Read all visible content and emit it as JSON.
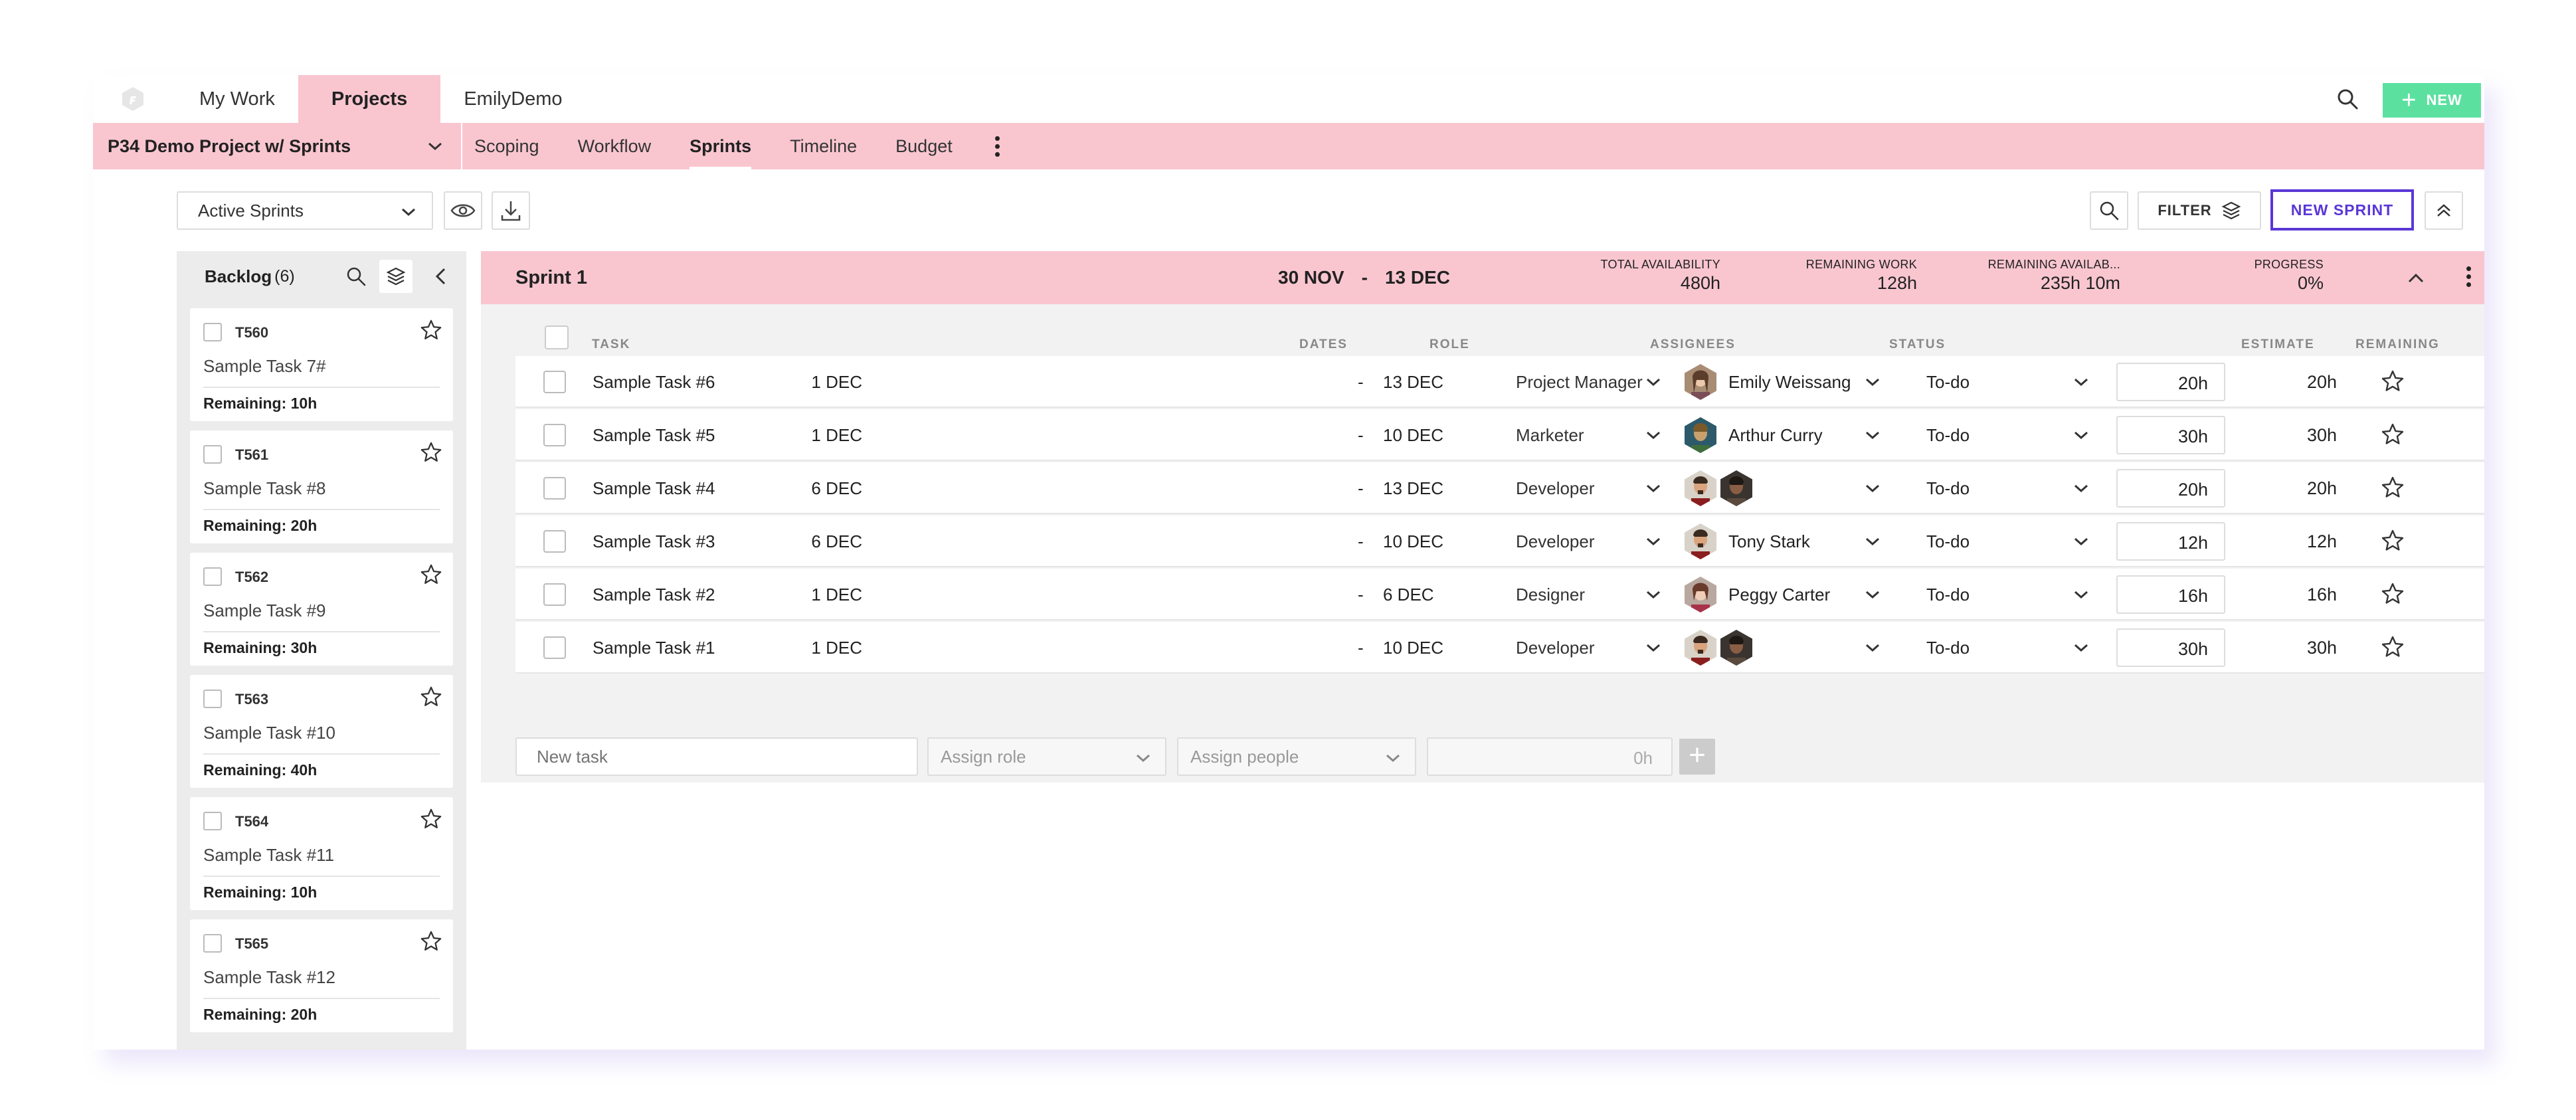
{
  "topnav": {
    "items": [
      {
        "label": "My Work"
      },
      {
        "label": "Projects"
      },
      {
        "label": "EmilyDemo"
      }
    ],
    "new_button": "NEW"
  },
  "projectbar": {
    "project_name": "P34 Demo Project w/ Sprints",
    "tabs": [
      {
        "label": "Scoping"
      },
      {
        "label": "Workflow"
      },
      {
        "label": "Sprints"
      },
      {
        "label": "Timeline"
      },
      {
        "label": "Budget"
      }
    ]
  },
  "toolbar": {
    "sprint_filter_value": "Active Sprints",
    "filter_label": "FILTER",
    "new_sprint_label": "NEW SPRINT"
  },
  "backlog": {
    "title": "Backlog",
    "count": "(6)",
    "cards": [
      {
        "id": "T560",
        "title": "Sample Task 7#",
        "remaining": "Remaining: 10h"
      },
      {
        "id": "T561",
        "title": "Sample Task #8",
        "remaining": "Remaining: 20h"
      },
      {
        "id": "T562",
        "title": "Sample Task #9",
        "remaining": "Remaining: 30h"
      },
      {
        "id": "T563",
        "title": "Sample Task #10",
        "remaining": "Remaining: 40h"
      },
      {
        "id": "T564",
        "title": "Sample Task #11",
        "remaining": "Remaining: 10h"
      },
      {
        "id": "T565",
        "title": "Sample Task #12",
        "remaining": "Remaining: 20h"
      }
    ]
  },
  "sprint": {
    "name": "Sprint 1",
    "start": "30 NOV",
    "separator": "-",
    "end": "13 DEC",
    "stats": [
      {
        "label": "TOTAL AVAILABILITY",
        "value": "480h"
      },
      {
        "label": "REMAINING WORK",
        "value": "128h"
      },
      {
        "label": "REMAINING AVAILAB...",
        "value": "235h 10m"
      },
      {
        "label": "PROGRESS",
        "value": "0%"
      }
    ],
    "columns": {
      "task": "TASK",
      "dates": "DATES",
      "role": "ROLE",
      "assignees": "ASSIGNEES",
      "status": "STATUS",
      "estimate": "ESTIMATE",
      "remaining": "REMAINING"
    },
    "tasks": [
      {
        "name": "Sample Task #6",
        "start": "1 DEC",
        "end": "13 DEC",
        "role": "Project Manager",
        "assignee": "Emily Weissang",
        "status": "To-do",
        "estimate": "20h",
        "remaining": "20h"
      },
      {
        "name": "Sample Task #5",
        "start": "1 DEC",
        "end": "10 DEC",
        "role": "Marketer",
        "assignee": "Arthur Curry",
        "status": "To-do",
        "estimate": "30h",
        "remaining": "30h"
      },
      {
        "name": "Sample Task #4",
        "start": "6 DEC",
        "end": "13 DEC",
        "role": "Developer",
        "assignee": "",
        "status": "To-do",
        "estimate": "20h",
        "remaining": "20h"
      },
      {
        "name": "Sample Task #3",
        "start": "6 DEC",
        "end": "10 DEC",
        "role": "Developer",
        "assignee": "Tony Stark",
        "status": "To-do",
        "estimate": "12h",
        "remaining": "12h"
      },
      {
        "name": "Sample Task #2",
        "start": "1 DEC",
        "end": "6 DEC",
        "role": "Designer",
        "assignee": "Peggy Carter",
        "status": "To-do",
        "estimate": "16h",
        "remaining": "16h"
      },
      {
        "name": "Sample Task #1",
        "start": "1 DEC",
        "end": "10 DEC",
        "role": "Developer",
        "assignee": "",
        "status": "To-do",
        "estimate": "30h",
        "remaining": "30h"
      }
    ],
    "new_task": {
      "placeholder": "New task",
      "role_placeholder": "Assign role",
      "people_placeholder": "Assign people",
      "hours_placeholder": "0h",
      "add_symbol": "+"
    }
  },
  "colors": {
    "accent_pink": "#f9c6d0",
    "new_button_green": "#5ce0a0",
    "new_sprint_purple": "#5a37d6"
  }
}
